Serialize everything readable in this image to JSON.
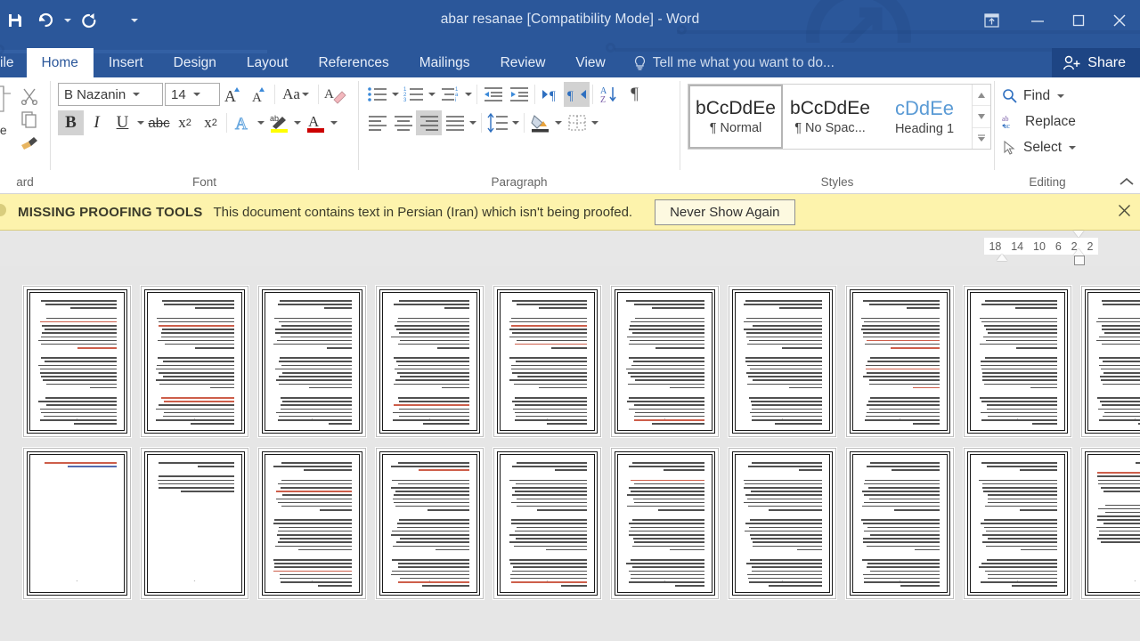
{
  "window": {
    "title": "abar resanae [Compatibility Mode] - Word",
    "quick_access": [
      {
        "name": "save-button",
        "icon": "save-icon"
      },
      {
        "name": "undo-button",
        "icon": "undo-icon",
        "has_dropdown": true
      },
      {
        "name": "redo-button",
        "icon": "redo-icon"
      },
      {
        "name": "customize-qat-button",
        "icon": "chevron-down-icon"
      }
    ],
    "controls": [
      {
        "name": "ribbon-display-options",
        "icon": "ribbon-options-icon"
      },
      {
        "name": "minimize-button",
        "icon": "minimize-icon"
      },
      {
        "name": "restore-button",
        "icon": "restore-icon"
      },
      {
        "name": "close-button",
        "icon": "close-icon"
      }
    ]
  },
  "tabs": [
    {
      "label": "ile",
      "active": false
    },
    {
      "label": "Home",
      "active": true
    },
    {
      "label": "Insert",
      "active": false
    },
    {
      "label": "Design",
      "active": false
    },
    {
      "label": "Layout",
      "active": false
    },
    {
      "label": "References",
      "active": false
    },
    {
      "label": "Mailings",
      "active": false
    },
    {
      "label": "Review",
      "active": false
    },
    {
      "label": "View",
      "active": false
    }
  ],
  "tell_me": "Tell me what you want to do...",
  "share_label": "Share",
  "ribbon": {
    "groups": [
      {
        "label": "ard",
        "name": "clipboard-group"
      },
      {
        "label": "Font",
        "name": "font-group"
      },
      {
        "label": "Paragraph",
        "name": "paragraph-group"
      },
      {
        "label": "Styles",
        "name": "styles-group"
      },
      {
        "label": "Editing",
        "name": "editing-group"
      }
    ],
    "clipboard": {
      "paste_label": "te"
    },
    "font": {
      "family_value": "B Nazanin",
      "size_value": "14",
      "grow_label": "A",
      "shrink_label": "A",
      "change_case_label": "Aa",
      "bold_label": "B",
      "italic_label": "I",
      "underline_label": "U",
      "strikethrough_label": "abc",
      "subscript_label": "x",
      "superscript_label": "x",
      "bold_active": true
    },
    "styles": [
      {
        "preview": "bCcDdEe",
        "name": "¶ Normal",
        "selected": true,
        "heading": false
      },
      {
        "preview": "bCcDdEe",
        "name": "¶ No Spac...",
        "selected": false,
        "heading": false
      },
      {
        "preview": "cDdEe",
        "name": "Heading 1",
        "selected": false,
        "heading": true
      }
    ],
    "editing": [
      {
        "label": "Find",
        "icon": "search-icon",
        "dropdown": true
      },
      {
        "label": "Replace",
        "icon": "replace-icon",
        "dropdown": false
      },
      {
        "label": "Select",
        "icon": "cursor-arrow-icon",
        "dropdown": true
      }
    ]
  },
  "message_bar": {
    "title": "MISSING PROOFING TOOLS",
    "text": "This document contains text in Persian (Iran) which isn't being proofed.",
    "button_label": "Never Show Again",
    "close_label": "✕",
    "background": "#fdf3ac"
  },
  "ruler": {
    "numbers": [
      "18",
      "14",
      "10",
      "6",
      "2",
      "2"
    ]
  },
  "document": {
    "page_count": 20,
    "columns": 10,
    "rows": 2,
    "page_number_label": "-",
    "language": "Persian (Iran)",
    "direction": "rtl"
  },
  "colors": {
    "title_bar": "#2b579a",
    "accent": "#2b579a",
    "share_button": "#1e4584",
    "message_bar": "#fdf3ac",
    "doc_background": "#e6e6e6",
    "highlight_yellow": "#ffff00",
    "font_color_red": "#cc0000"
  }
}
